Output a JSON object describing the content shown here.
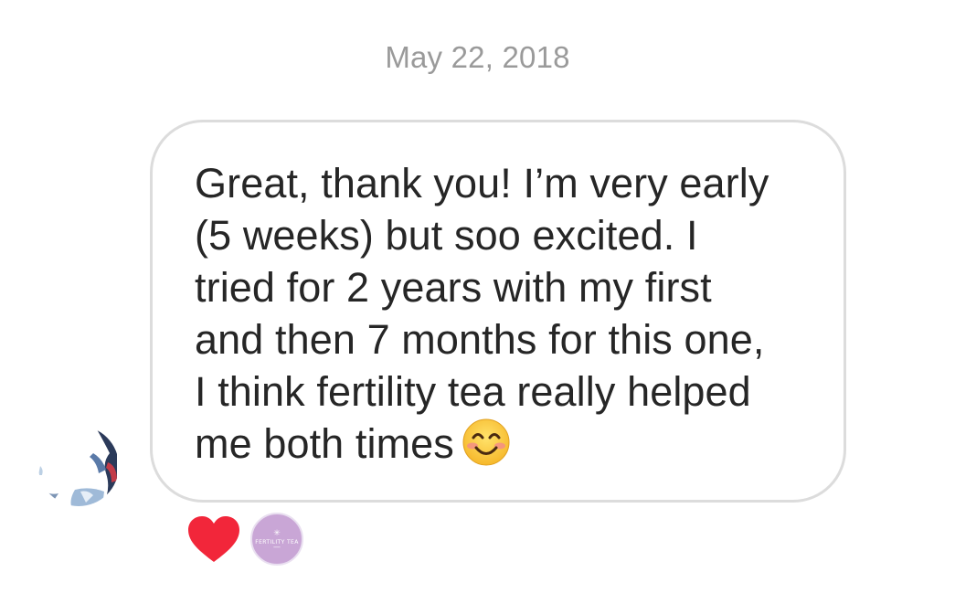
{
  "thread": {
    "timestamp": "May 22, 2018"
  },
  "message": {
    "text": "Great, thank you! I’m very early\n(5 weeks) but soo excited. I\ntried for 2 years with my first\nand then 7 months for this one,\nI think fertility tea really helped\nme both times",
    "emoji": "smiling-face-with-smiling-eyes-emoji"
  },
  "sender_avatar": {
    "icon": "sender-avatar-image"
  },
  "reactions": {
    "heart": {
      "icon": "heart-icon",
      "color": "#f2263a"
    },
    "reactor": {
      "brand_text": "FERTILITY TEA",
      "star": "✳",
      "color": "#c9a6d6"
    }
  }
}
